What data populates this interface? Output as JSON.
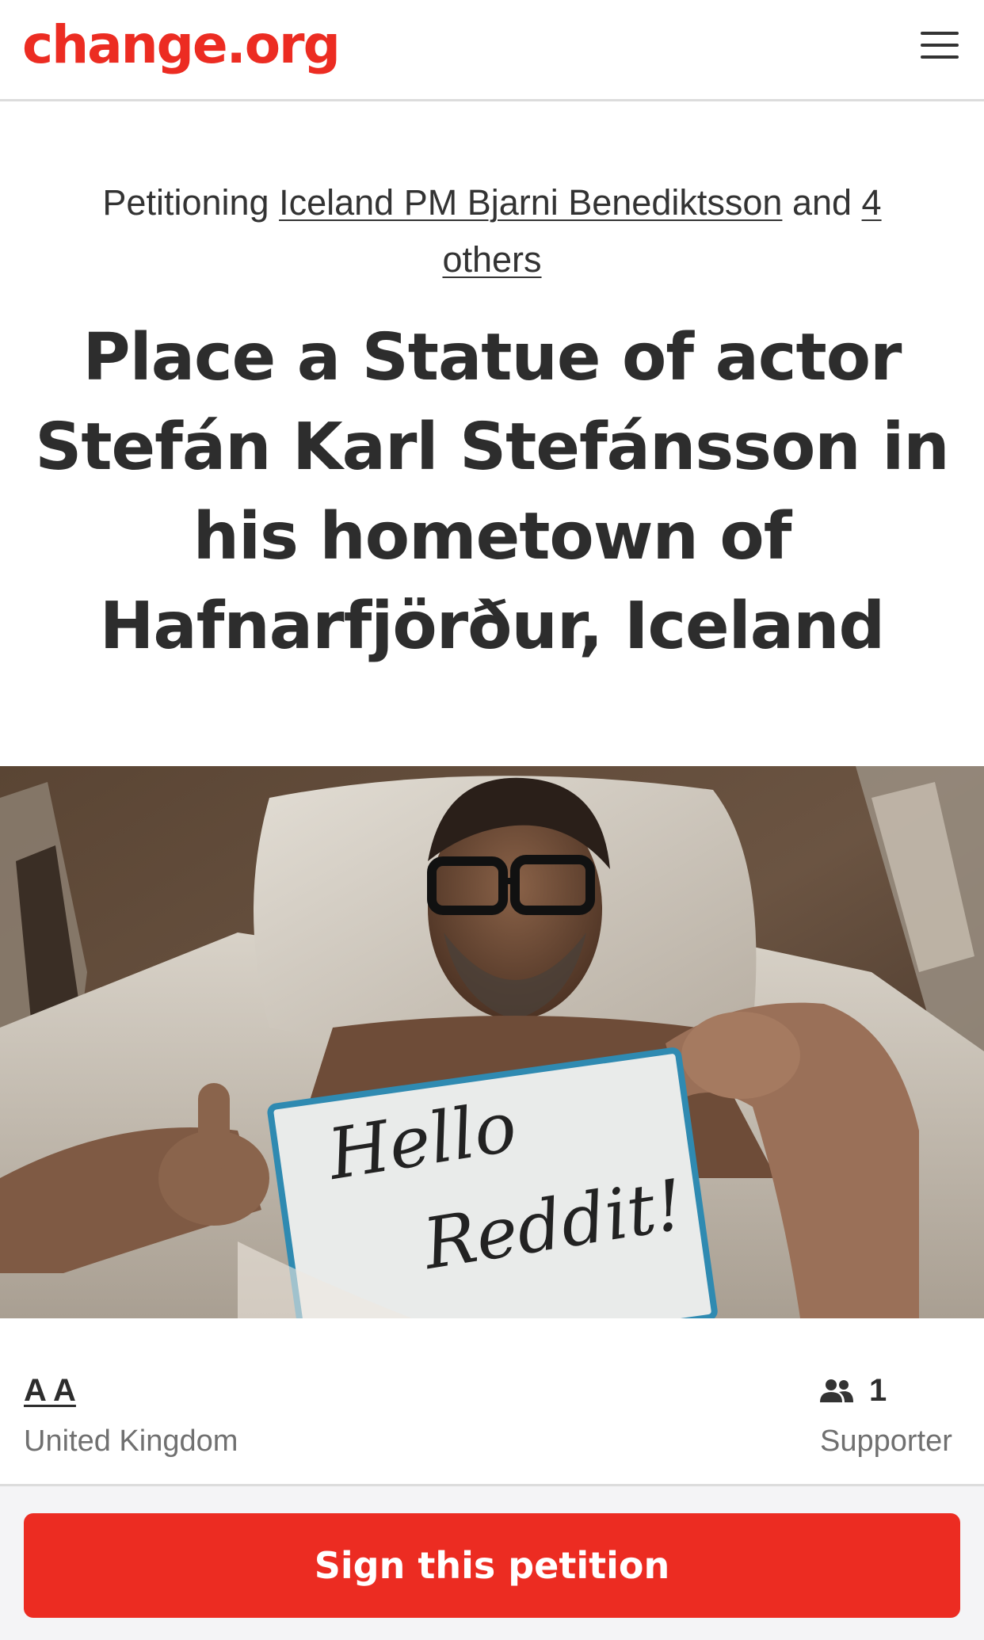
{
  "header": {
    "logo_text": "change.org",
    "menu_icon": "hamburger-menu-icon"
  },
  "petition": {
    "petitioning_prefix": "Petitioning",
    "target_primary": "Iceland PM Bjarni Benediktsson",
    "and_text": "and",
    "others_link": "4 others",
    "title": "Place a Statue of actor Stefán Karl Stefánsson in his hometown of Hafnarfjörður, Iceland"
  },
  "photo": {
    "whiteboard_line1": "Hello",
    "whiteboard_line2": "Reddit!"
  },
  "author": {
    "name": "A A",
    "location": "United Kingdom"
  },
  "supporters": {
    "icon": "people-icon",
    "count": "1",
    "label": "Supporter"
  },
  "cta": {
    "sign_label": "Sign this petition"
  },
  "colors": {
    "brand_red": "#ec2c22",
    "text_dark": "#2d2d2d",
    "text_muted": "#707070"
  }
}
